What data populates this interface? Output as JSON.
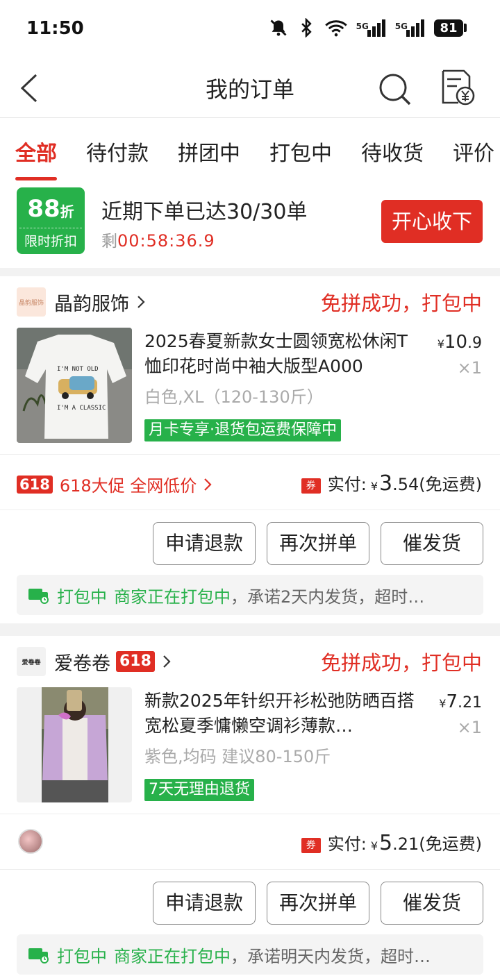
{
  "status_bar": {
    "time": "11:50",
    "battery": "81",
    "network1": "5G",
    "network2": "5G"
  },
  "header": {
    "title": "我的订单"
  },
  "tabs": [
    {
      "label": "全部",
      "active": true
    },
    {
      "label": "待付款"
    },
    {
      "label": "拼团中"
    },
    {
      "label": "打包中"
    },
    {
      "label": "待收货"
    },
    {
      "label": "评价"
    }
  ],
  "promo": {
    "discount": "88",
    "discount_unit": "折",
    "badge_text": "限时折扣",
    "title": "近期下单已达30/30单",
    "timer_prefix": "剩",
    "timer": "00:58:36.9",
    "button": "开心收下"
  },
  "orders": [
    {
      "shop_name": "晶韵服饰",
      "shop_logo_text": "晶韵服饰",
      "status": "免拼成功，打包中",
      "title": "2025春夏新款女士圆领宽松休闲T恤印花时尚中袖大版型A000",
      "price_symbol": "¥",
      "price_int": "10",
      "price_dec": ".9",
      "qty": "×1",
      "spec": "白色,XL（120-130斤）",
      "service_tag": "月卡专享·退货包运费保障中",
      "promo_badge": "618",
      "promo_text": "618大促 全网低价",
      "coupon_label": "券",
      "pay_label": "实付:",
      "pay_symbol": "¥",
      "pay_int": "3",
      "pay_dec": ".54",
      "pay_note": "(免运费)",
      "actions": [
        "申请退款",
        "再次拼单",
        "催发货"
      ],
      "ship_status": "打包中",
      "ship_desc": "商家正在打包中",
      "ship_detail": "，承诺2天内发货，超时…"
    },
    {
      "shop_name": "爱卷卷",
      "shop_logo_text": "爱卷卷",
      "shop_badge": "618",
      "status": "免拼成功，打包中",
      "title": "新款2025年针织开衫松弛防晒百搭宽松夏季慵懒空调衫薄款…",
      "price_symbol": "¥",
      "price_int": "7",
      "price_dec": ".21",
      "qty": "×1",
      "spec": "紫色,均码 建议80-150斤",
      "service_tag": "7天无理由退货",
      "coupon_label": "券",
      "pay_label": "实付:",
      "pay_symbol": "¥",
      "pay_int": "5",
      "pay_dec": ".21",
      "pay_note": "(免运费)",
      "actions": [
        "申请退款",
        "再次拼单",
        "催发货"
      ],
      "ship_status": "打包中",
      "ship_desc": "商家正在打包中",
      "ship_detail": "，承诺明天内发货，超时…"
    }
  ]
}
